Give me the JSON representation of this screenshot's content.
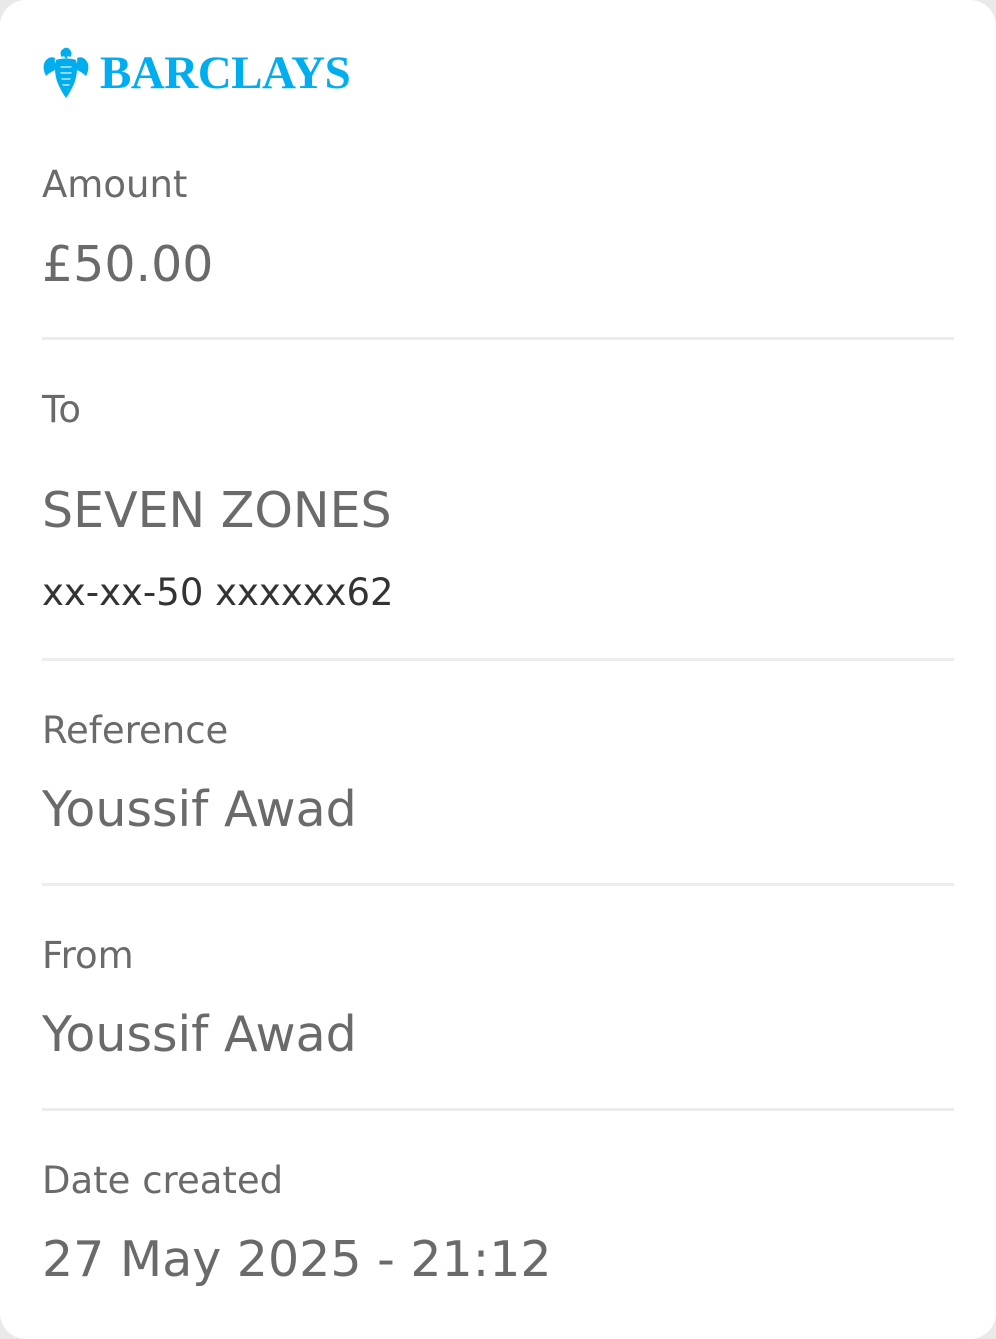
{
  "brand": {
    "name": "BARCLAYS",
    "logo_icon": "eagle-icon",
    "color": "#00aeef"
  },
  "amount": {
    "label": "Amount",
    "value": "£50.00"
  },
  "to": {
    "label": "To",
    "name": "SEVEN ZONES",
    "account": "xx-xx-50 xxxxxx62"
  },
  "reference": {
    "label": "Reference",
    "value": "Youssif Awad"
  },
  "from": {
    "label": "From",
    "value": "Youssif Awad"
  },
  "date_created": {
    "label": "Date created",
    "value": "27 May 2025 - 21:12"
  },
  "colors": {
    "label_text": "#6a6a6a",
    "value_text": "#6a6a6a",
    "account_text": "#333333",
    "divider": "#ececec"
  }
}
